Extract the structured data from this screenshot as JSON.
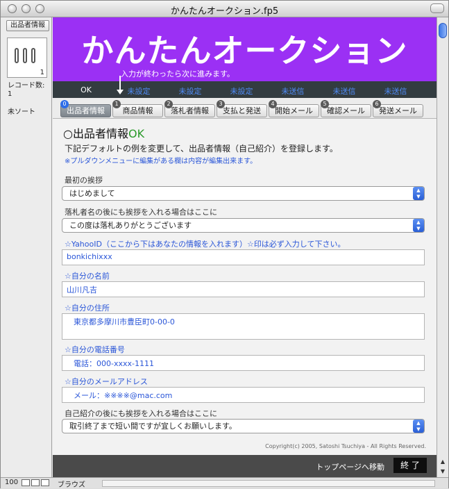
{
  "window": {
    "title": "かんたんオークション.fp5"
  },
  "sidebar": {
    "layout_label": "出品者情報",
    "page_number": "1",
    "record_label": "レコード数:",
    "record_count": "1",
    "sort_status": "未ソート"
  },
  "banner": {
    "title": "かんたんオークション",
    "subtitle": "入力が終わったら次に進みます。"
  },
  "statuses": [
    "OK",
    "未設定",
    "未設定",
    "未設定",
    "未送信",
    "未送信",
    "未送信"
  ],
  "tabs": [
    {
      "num": "0",
      "label": "出品者情報"
    },
    {
      "num": "1",
      "label": "商品情報"
    },
    {
      "num": "2",
      "label": "落札者情報"
    },
    {
      "num": "3",
      "label": "支払と発送"
    },
    {
      "num": "4",
      "label": "開始メール"
    },
    {
      "num": "5",
      "label": "確認メール"
    },
    {
      "num": "6",
      "label": "発送メール"
    }
  ],
  "heading": {
    "prefix": "○出品者情報",
    "status": "OK"
  },
  "description": "下記デフォルトの例を変更して、出品者情報（自己紹介）を登録します。",
  "note": "※プルダウンメニューに編集がある欄は内容が編集出来ます。",
  "fields": {
    "greeting": {
      "label": "最初の挨拶",
      "value": "はじめまして"
    },
    "winner_greeting": {
      "label": "落札者名の後にも挨拶を入れる場合はここに",
      "value": "この度は落札ありがとうございます"
    },
    "yahoo_id": {
      "label": "☆YahooID（ここから下はあなたの情報を入れます）☆印は必ず入力して下さい。",
      "value": "bonkichixxx"
    },
    "name": {
      "label": "☆自分の名前",
      "value": "山川凡吉"
    },
    "address": {
      "label": "☆自分の住所",
      "value": "東京都多摩川市豊臣町0-00-0"
    },
    "phone": {
      "label": "☆自分の電話番号",
      "value": "電話：000-xxxx-1111"
    },
    "email": {
      "label": "☆自分のメールアドレス",
      "value": "メール：※※※※@mac.com"
    },
    "intro_greeting": {
      "label": "自己紹介の後にも挨拶を入れる場合はここに",
      "value": "取引終了まで短い間ですが宜しくお願いします。"
    }
  },
  "copyright": "Copyright(c) 2005, Satoshi Tsuchiya - All Rights Reserved.",
  "footer": {
    "nav_link": "トップページへ移動",
    "exit_label": "終 了"
  },
  "statusbar": {
    "zoom": "100",
    "mode": "ブラウズ"
  },
  "colors": {
    "banner": "#9b30f4",
    "status_bar": "#333c40",
    "link_blue": "#2a56d8",
    "ok_green": "#2a9a2a"
  }
}
